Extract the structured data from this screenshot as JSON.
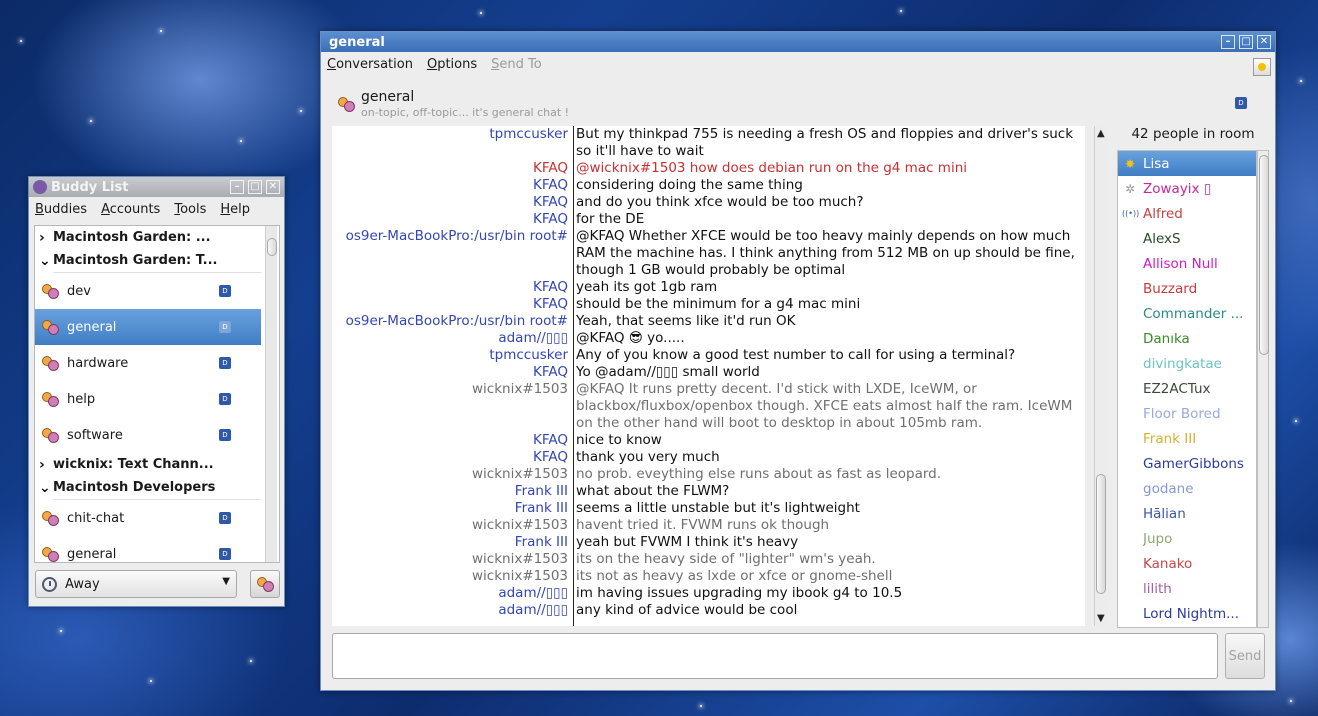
{
  "buddy_window": {
    "title": "Buddy List",
    "menu": [
      "Buddies",
      "Accounts",
      "Tools",
      "Help"
    ],
    "tree": [
      {
        "type": "group",
        "label": "Macintosh Garden: ...",
        "expanded": false
      },
      {
        "type": "group",
        "label": "Macintosh Garden: T...",
        "expanded": true
      },
      {
        "type": "channel",
        "label": "dev"
      },
      {
        "type": "channel",
        "label": "general",
        "selected": true
      },
      {
        "type": "channel",
        "label": "hardware"
      },
      {
        "type": "channel",
        "label": "help"
      },
      {
        "type": "channel",
        "label": "software"
      },
      {
        "type": "group",
        "label": "wicknix: Text Chann...",
        "expanded": false
      },
      {
        "type": "group",
        "label": "Macintosh Developers",
        "expanded": true
      },
      {
        "type": "channel",
        "label": "chit-chat"
      },
      {
        "type": "channel",
        "label": "general"
      }
    ],
    "status": "Away"
  },
  "chat_window": {
    "title": "general",
    "menu": {
      "conversation": "Conversation",
      "options": "Options",
      "send_to": "Send To"
    },
    "channel_name": "general",
    "topic": "on-topic, off-topic... it's general chat !",
    "occupant_count": "42 people in room",
    "send_label": "Send",
    "input_value": "",
    "messages": [
      {
        "who": "tpmccusker",
        "who_color": "blue",
        "text": "But my thinkpad 755 is needing a fresh OS and floppies and driver's suck so it'll have to wait",
        "text_color": "normal"
      },
      {
        "who": "KFAQ",
        "who_color": "red",
        "text": "@wicknix#1503 how does debian run on the g4 mac mini",
        "text_color": "red"
      },
      {
        "who": "KFAQ",
        "who_color": "blue",
        "text": "considering doing the same thing",
        "text_color": "normal"
      },
      {
        "who": "KFAQ",
        "who_color": "blue",
        "text": "and do you think xfce would be too much?",
        "text_color": "normal"
      },
      {
        "who": "KFAQ",
        "who_color": "blue",
        "text": "for the DE",
        "text_color": "normal"
      },
      {
        "who": "os9er-MacBookPro:/usr/bin root#",
        "who_color": "blue",
        "text": "@KFAQ Whether XFCE would be too heavy mainly depends on how much RAM the machine has. I think anything from 512 MB on up should be fine, though 1 GB would probably be optimal",
        "text_color": "normal"
      },
      {
        "who": "KFAQ",
        "who_color": "blue",
        "text": "yeah its got 1gb ram",
        "text_color": "normal"
      },
      {
        "who": "KFAQ",
        "who_color": "blue",
        "text": "should be the minimum for a g4 mac mini",
        "text_color": "normal"
      },
      {
        "who": "os9er-MacBookPro:/usr/bin root#",
        "who_color": "blue",
        "text": "Yeah, that seems like it'd run OK",
        "text_color": "normal"
      },
      {
        "who": "adam//▯▯▯",
        "who_color": "blue",
        "text": "@KFAQ 😎 yo.....",
        "text_color": "normal"
      },
      {
        "who": "tpmccusker",
        "who_color": "blue",
        "text": "Any of you know a good test number to call for using a terminal?",
        "text_color": "normal"
      },
      {
        "who": "KFAQ",
        "who_color": "blue",
        "text": "Yo @adam//▯▯▯ small world",
        "text_color": "normal"
      },
      {
        "who": "wicknix#1503",
        "who_color": "gray",
        "text": "@KFAQ It runs pretty decent. I'd stick with LXDE, IceWM, or blackbox/fluxbox/openbox though. XFCE eats almost half the ram. IceWM on the other hand will boot to desktop in about 105mb ram.",
        "text_color": "gray"
      },
      {
        "who": "KFAQ",
        "who_color": "blue",
        "text": "nice to know",
        "text_color": "normal"
      },
      {
        "who": "KFAQ",
        "who_color": "blue",
        "text": "thank you very much",
        "text_color": "normal"
      },
      {
        "who": "wicknix#1503",
        "who_color": "gray",
        "text": "no prob. eveything else runs about as fast as leopard.",
        "text_color": "gray"
      },
      {
        "who": "Frank III",
        "who_color": "blue",
        "text": "what about the FLWM?",
        "text_color": "normal"
      },
      {
        "who": "Frank III",
        "who_color": "blue",
        "text": "seems a little unstable but it's lightweight",
        "text_color": "normal"
      },
      {
        "who": "wicknix#1503",
        "who_color": "gray",
        "text": "havent tried it. FVWM runs ok though",
        "text_color": "gray"
      },
      {
        "who": "Frank III",
        "who_color": "blue",
        "text": "yeah but FVWM I think it's heavy",
        "text_color": "normal"
      },
      {
        "who": "wicknix#1503",
        "who_color": "gray",
        "text": "its on the heavy side of \"lighter\" wm's yeah.",
        "text_color": "gray"
      },
      {
        "who": "wicknix#1503",
        "who_color": "gray",
        "text": "its not as heavy as lxde or xfce or gnome-shell",
        "text_color": "gray"
      },
      {
        "who": "adam//▯▯▯",
        "who_color": "blue",
        "text": "im having issues upgrading my ibook g4 to 10.5",
        "text_color": "normal"
      },
      {
        "who": "adam//▯▯▯",
        "who_color": "blue",
        "text": "any kind of advice would be cool",
        "text_color": "normal"
      }
    ],
    "occupants": [
      {
        "name": "Lisa",
        "color": "#ffffff",
        "icon": "star-icon",
        "selected": true
      },
      {
        "name": "Zowayix ▯",
        "color": "#c8279a",
        "icon": "star-outline-icon"
      },
      {
        "name": "Alfred",
        "color": "#c94040",
        "icon": "broadcast-icon"
      },
      {
        "name": "AlexS",
        "color": "#2a4a2a",
        "icon": ""
      },
      {
        "name": "Allison Null",
        "color": "#d21cc8",
        "icon": ""
      },
      {
        "name": "Buzzard",
        "color": "#c33c3c",
        "icon": ""
      },
      {
        "name": "Commander ...",
        "color": "#2a8a86",
        "icon": ""
      },
      {
        "name": "Danıka",
        "color": "#3a8a2a",
        "icon": ""
      },
      {
        "name": "divingkatae",
        "color": "#6bc4c0",
        "icon": ""
      },
      {
        "name": "EZ2ACTux",
        "color": "#3a4a3a",
        "icon": ""
      },
      {
        "name": "Floor Bored",
        "color": "#9aa8e0",
        "icon": ""
      },
      {
        "name": "Frank III",
        "color": "#d8b030",
        "icon": ""
      },
      {
        "name": "GamerGibbons",
        "color": "#2a3aa0",
        "icon": ""
      },
      {
        "name": "godane",
        "color": "#8898d8",
        "icon": ""
      },
      {
        "name": "Hālian",
        "color": "#3a58a8",
        "icon": ""
      },
      {
        "name": "Jupo",
        "color": "#8aaa70",
        "icon": ""
      },
      {
        "name": "Kanako",
        "color": "#c84848",
        "icon": ""
      },
      {
        "name": "lilith",
        "color": "#a060a8",
        "icon": ""
      },
      {
        "name": "Lord Nightm...",
        "color": "#2a3aa0",
        "icon": ""
      }
    ]
  },
  "colors": {
    "title_active": "#3b6eb6",
    "selection": "#4a86cc",
    "nick_blue": "#3346b5",
    "nick_red": "#c93030",
    "nick_gray": "#707070"
  }
}
